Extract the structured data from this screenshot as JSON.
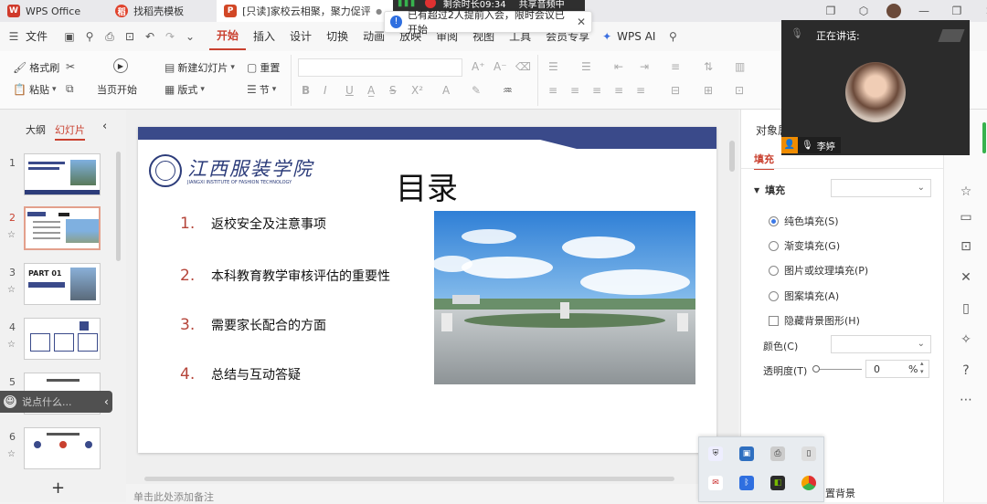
{
  "tabs": [
    {
      "label": "WPS Office",
      "logo": "W",
      "color": "#d03a2b"
    },
    {
      "label": "找稻壳模板",
      "logo": "稻",
      "color": "#e0432d"
    },
    {
      "label": "[只读]家校云相聚，聚力促评估",
      "logo": "P",
      "color": "#d24726"
    }
  ],
  "tab_extras": {
    "dot": "●",
    "add": "+"
  },
  "meeting": {
    "timer": "剩余时长09:34",
    "share": "共享音频中",
    "notice": "已有超过2人提前入会，限时会议已开始",
    "speaking_label": "正在讲话:",
    "speaker_name": "李婷"
  },
  "window_icons": [
    "copy-icon",
    "cube-icon",
    "avatar",
    "minimize-icon",
    "restore-icon",
    "close-icon"
  ],
  "menu": {
    "file": "文件",
    "items": [
      "开始",
      "插入",
      "设计",
      "切换",
      "动画",
      "放映",
      "审阅",
      "视图",
      "工具",
      "会员专享"
    ],
    "wps_ai": "WPS AI"
  },
  "ribbon": {
    "format_painter": "格式刷",
    "paste": "粘贴",
    "play_from_current": "当页开始",
    "new_slide": "新建幻灯片",
    "layout": "版式",
    "reset": "重置",
    "section": "节"
  },
  "left_panel": {
    "outline_tab": "大纲",
    "slides_tab": "幻灯片",
    "slide_numbers": [
      "1",
      "2",
      "3",
      "4",
      "5",
      "6"
    ],
    "slide3_badge": "PART 01",
    "chat_placeholder": "说点什么...",
    "add": "+"
  },
  "slide": {
    "logo_cn": "江西服装学院",
    "logo_en": "JIANGXI INSTITUTE OF FASHION TECHNOLOGY",
    "title": "目录",
    "items": [
      {
        "num": "1.",
        "text": "返校安全及注意事项"
      },
      {
        "num": "2.",
        "text": "本科教育教学审核评估的重要性"
      },
      {
        "num": "3.",
        "text": "需要家长配合的方面"
      },
      {
        "num": "4.",
        "text": "总结与互动答疑"
      }
    ]
  },
  "notes_placeholder": "单击此处添加备注",
  "right_panel": {
    "header": "对象属",
    "fill_tab": "填充",
    "fill_section": "填充",
    "options": [
      "纯色填充(S)",
      "渐变填充(G)",
      "图片或纹理填充(P)",
      "图案填充(A)"
    ],
    "hide_bg": "隐藏背景图形(H)",
    "color_label": "颜色(C)",
    "transparency_label": "透明度(T)",
    "transparency_value": "0",
    "transparency_unit": "%",
    "apply_bg": "置背景"
  }
}
